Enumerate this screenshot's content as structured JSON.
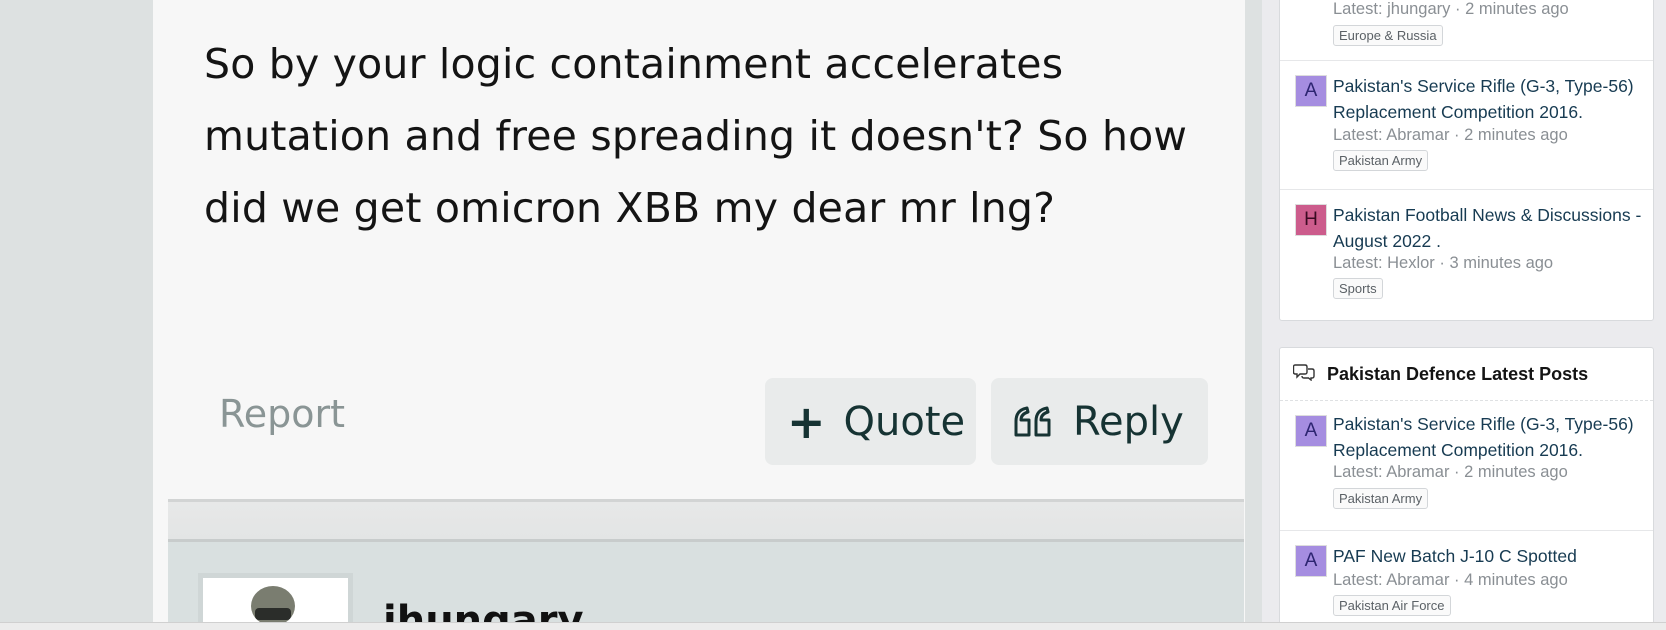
{
  "post": {
    "text": "So by your logic containment accelerates mutation and free spreading it doesn't? So how did we get omicron XBB my dear mr lng?",
    "report_label": "Report",
    "quote_label": "Quote",
    "reply_label": "Reply"
  },
  "next_post": {
    "username": "jhungary"
  },
  "sidebar": {
    "widget_top": {
      "threads": [
        {
          "title": "",
          "meta": "Latest: jhungary · 2 minutes ago",
          "tag": "Europe & Russia"
        },
        {
          "avatar": "A",
          "title": "Pakistan's Service Rifle (G-3, Type-56) Replacement Competition 2016.",
          "meta": "Latest: Abramar · 2 minutes ago",
          "tag": "Pakistan Army"
        },
        {
          "avatar": "H",
          "title": "Pakistan Football News & Discussions - August 2022 .",
          "meta": "Latest: Hexlor · 3 minutes ago",
          "tag": "Sports"
        }
      ]
    },
    "widget_latest": {
      "title": "Pakistan Defence Latest Posts",
      "threads": [
        {
          "avatar": "A",
          "title": "Pakistan's Service Rifle (G-3, Type-56) Replacement Competition 2016.",
          "meta": "Latest: Abramar · 2 minutes ago",
          "tag": "Pakistan Army"
        },
        {
          "avatar": "A",
          "title": "PAF New Batch J-10 C Spotted",
          "meta": "Latest: Abramar · 4 minutes ago",
          "tag": "Pakistan Air Force"
        }
      ]
    }
  },
  "colors": {
    "page_bg": "#dde1e1",
    "post_bg": "#f7f7f7",
    "button_bg": "#e9ebeb",
    "button_text": "#163333",
    "link_text": "#173b52",
    "avatar_a": "#a58de0",
    "avatar_h": "#cc5c8c"
  },
  "icons": {
    "quote": "plus-icon",
    "reply": "quote-marks-icon",
    "widget_latest": "comments-icon"
  }
}
